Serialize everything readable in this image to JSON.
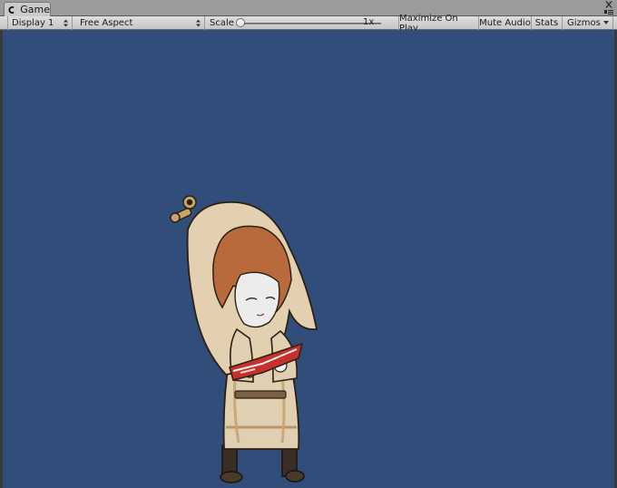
{
  "tab": {
    "label": "Game",
    "icon": "game-controller-icon"
  },
  "window_controls": {
    "close": "close-icon",
    "menu": "menu-icon"
  },
  "toolbar": {
    "display": {
      "selected": "Display 1"
    },
    "aspect": {
      "selected": "Free Aspect"
    },
    "scale": {
      "label": "Scale",
      "value": "1x",
      "slider_fraction": 0
    },
    "maximize_on_play": "Maximize On Play",
    "mute_audio": "Mute Audio",
    "stats": "Stats",
    "gizmos": "Gizmos"
  },
  "viewport": {
    "background_color": "#314d7a",
    "sprite": "girl-reading-book-sprite"
  }
}
